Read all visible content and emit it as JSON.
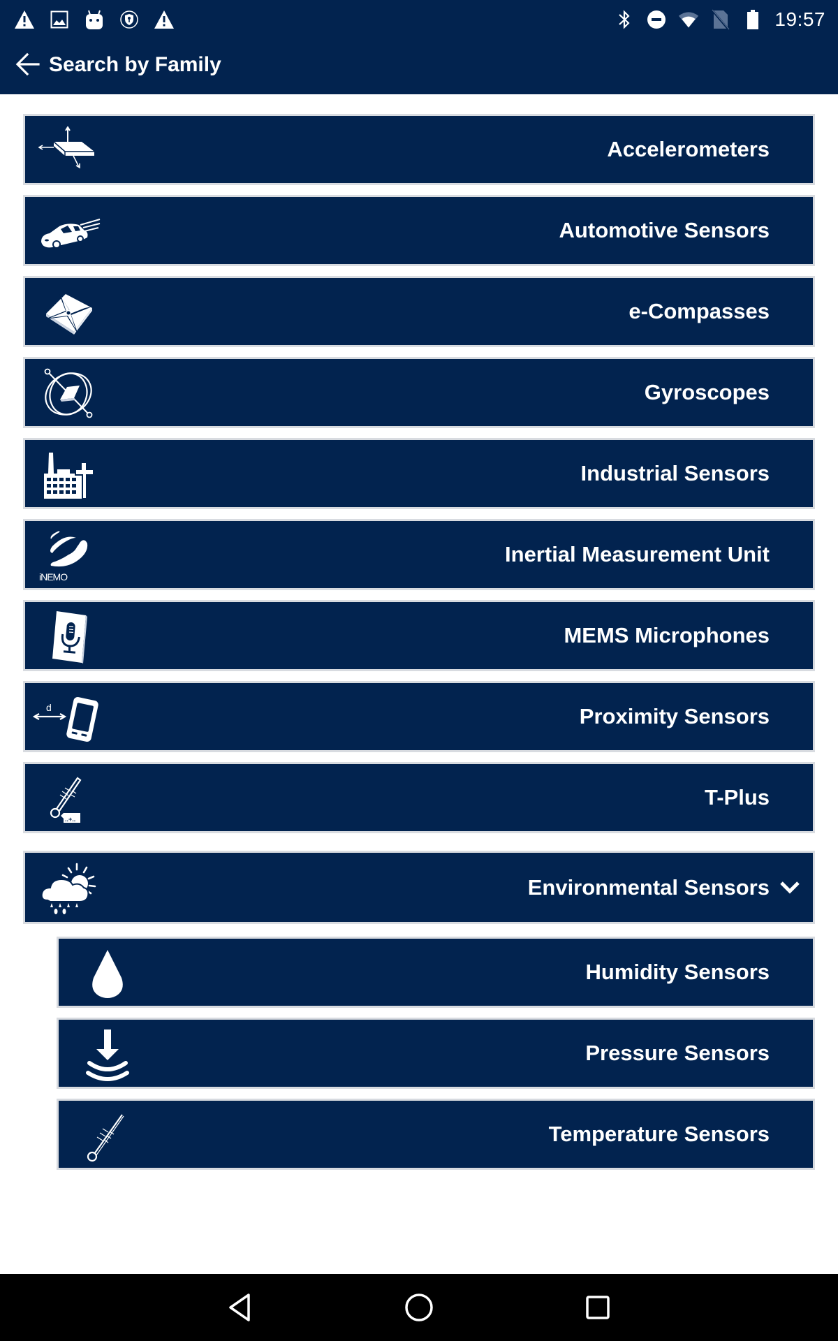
{
  "status_bar": {
    "left_icons": [
      "warning-icon",
      "image-icon",
      "android-icon",
      "vpn-key-icon",
      "warning-icon"
    ],
    "right_icons": [
      "bluetooth-icon",
      "do-not-disturb-icon",
      "wifi-icon",
      "no-sim-icon",
      "battery-icon"
    ],
    "time": "19:57"
  },
  "app_bar": {
    "back_icon": "arrow-back-icon",
    "title": "Search by Family"
  },
  "families": [
    {
      "label": "Accelerometers",
      "icon": "accelerometer-icon"
    },
    {
      "label": "Automotive Sensors",
      "icon": "car-icon"
    },
    {
      "label": "e-Compasses",
      "icon": "compass-icon"
    },
    {
      "label": "Gyroscopes",
      "icon": "gyroscope-icon"
    },
    {
      "label": "Industrial Sensors",
      "icon": "factory-icon"
    },
    {
      "label": "Inertial Measurement Unit",
      "icon": "inemo-icon",
      "icon_caption": "iNEMO"
    },
    {
      "label": "MEMS Microphones",
      "icon": "microphone-icon"
    },
    {
      "label": "Proximity Sensors",
      "icon": "proximity-icon",
      "icon_caption": "d"
    },
    {
      "label": "T-Plus",
      "icon": "thermometer-plus-icon",
      "icon_caption": "..+.."
    }
  ],
  "expanded_family": {
    "label": "Environmental Sensors",
    "icon": "weather-icon",
    "state": "expanded",
    "chevron_icon": "chevron-down-icon",
    "children": [
      {
        "label": "Humidity Sensors",
        "icon": "water-drop-icon"
      },
      {
        "label": "Pressure Sensors",
        "icon": "pressure-icon"
      },
      {
        "label": "Temperature Sensors",
        "icon": "thermometer-icon"
      }
    ]
  },
  "nav_bar": {
    "buttons": [
      "back-triangle-icon",
      "home-circle-icon",
      "recents-square-icon"
    ]
  },
  "colors": {
    "primary": "#02234f",
    "background": "#ffffff",
    "item_border": "#d8dbe0",
    "text": "#ffffff"
  }
}
